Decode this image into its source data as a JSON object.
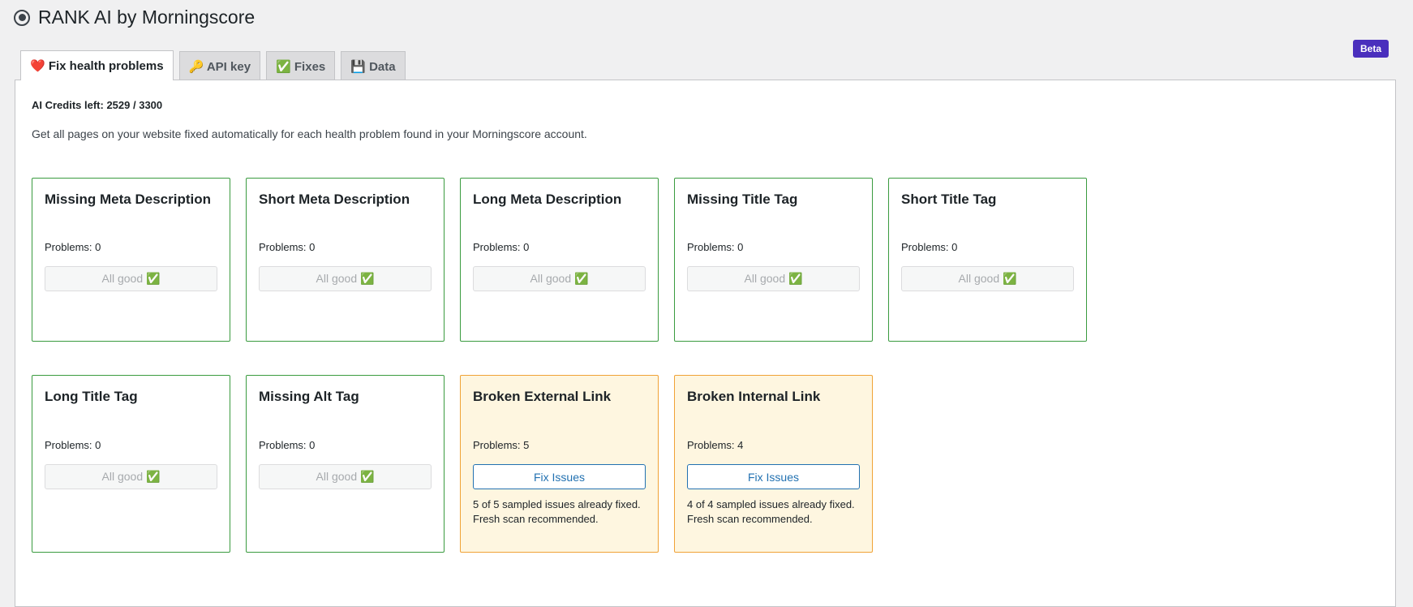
{
  "header": {
    "title": "RANK AI by Morningscore"
  },
  "beta_label": "Beta",
  "tabs": [
    {
      "label": "❤️ Fix health problems"
    },
    {
      "label": "🔑 API key"
    },
    {
      "label": "✅ Fixes"
    },
    {
      "label": "💾 Data"
    }
  ],
  "credits": "AI Credits left: 2529 / 3300",
  "intro": "Get all pages on your website fixed automatically for each health problem found in your Morningscore account.",
  "cards": [
    {
      "title": "Missing Meta Description",
      "problems": "Problems: 0",
      "button": "All good ✅"
    },
    {
      "title": "Short Meta Description",
      "problems": "Problems: 0",
      "button": "All good ✅"
    },
    {
      "title": "Long Meta Description",
      "problems": "Problems: 0",
      "button": "All good ✅"
    },
    {
      "title": "Missing Title Tag",
      "problems": "Problems: 0",
      "button": "All good ✅"
    },
    {
      "title": "Short Title Tag",
      "problems": "Problems: 0",
      "button": "All good ✅"
    },
    {
      "title": "Long Title Tag",
      "problems": "Problems: 0",
      "button": "All good ✅"
    },
    {
      "title": "Missing Alt Tag",
      "problems": "Problems: 0",
      "button": "All good ✅"
    },
    {
      "title": "Broken External Link",
      "problems": "Problems: 5",
      "button": "Fix Issues",
      "note": "5 of 5 sampled issues already fixed. Fresh scan recommended."
    },
    {
      "title": "Broken Internal Link",
      "problems": "Problems: 4",
      "button": "Fix Issues",
      "note": "4 of 4 sampled issues already fixed. Fresh scan recommended."
    }
  ],
  "colors": {
    "ok_border": "#3a9b3f",
    "warn_border": "#f0a236",
    "warn_bg": "#fef6e0",
    "accent": "#2271b1",
    "beta": "#4a2fbd"
  }
}
